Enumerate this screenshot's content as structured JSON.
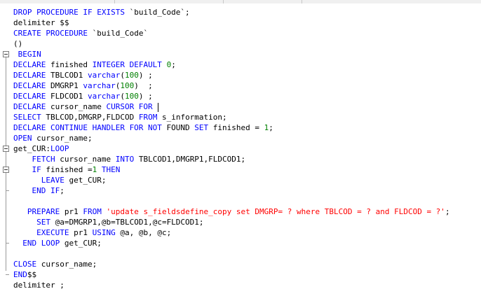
{
  "editor": {
    "colors": {
      "keyword": "#0000ff",
      "number": "#008000",
      "string": "#ff0000",
      "text": "#000000"
    },
    "lines": [
      [
        {
          "t": "DROP PROCEDURE IF EXISTS",
          "c": "kw"
        },
        {
          "t": " `build_Code`;",
          "c": "txt"
        }
      ],
      [
        {
          "t": "delimiter $$",
          "c": "txt"
        }
      ],
      [
        {
          "t": "CREATE PROCEDURE",
          "c": "kw"
        },
        {
          "t": " `build_Code`",
          "c": "txt"
        }
      ],
      [
        {
          "t": "()",
          "c": "txt"
        }
      ],
      [
        {
          "t": " BEGIN",
          "c": "kw"
        }
      ],
      [
        {
          "t": "DECLARE",
          "c": "kw"
        },
        {
          "t": " finished ",
          "c": "txt"
        },
        {
          "t": "INTEGER DEFAULT",
          "c": "kw"
        },
        {
          "t": " ",
          "c": "txt"
        },
        {
          "t": "0",
          "c": "num"
        },
        {
          "t": ";",
          "c": "txt"
        }
      ],
      [
        {
          "t": "DECLARE",
          "c": "kw"
        },
        {
          "t": " TBLCOD1 ",
          "c": "txt"
        },
        {
          "t": "varchar",
          "c": "kw"
        },
        {
          "t": "(",
          "c": "txt"
        },
        {
          "t": "100",
          "c": "num"
        },
        {
          "t": ") ;",
          "c": "txt"
        }
      ],
      [
        {
          "t": "DECLARE",
          "c": "kw"
        },
        {
          "t": " DMGRP1 ",
          "c": "txt"
        },
        {
          "t": "varchar",
          "c": "kw"
        },
        {
          "t": "(",
          "c": "txt"
        },
        {
          "t": "100",
          "c": "num"
        },
        {
          "t": ")  ;",
          "c": "txt"
        }
      ],
      [
        {
          "t": "DECLARE",
          "c": "kw"
        },
        {
          "t": " FLDCOD1 ",
          "c": "txt"
        },
        {
          "t": "varchar",
          "c": "kw"
        },
        {
          "t": "(",
          "c": "txt"
        },
        {
          "t": "100",
          "c": "num"
        },
        {
          "t": ") ;",
          "c": "txt"
        }
      ],
      [
        {
          "t": "DECLARE",
          "c": "kw"
        },
        {
          "t": " cursor_name ",
          "c": "txt"
        },
        {
          "t": "CURSOR FOR",
          "c": "kw"
        },
        {
          "t": " ",
          "c": "txt"
        }
      ],
      [
        {
          "t": "SELECT",
          "c": "kw"
        },
        {
          "t": " TBLCOD,DMGRP,FLDCOD ",
          "c": "txt"
        },
        {
          "t": "FROM",
          "c": "kw"
        },
        {
          "t": " s_information;",
          "c": "txt"
        }
      ],
      [
        {
          "t": "DECLARE CONTINUE HANDLER FOR NOT",
          "c": "kw"
        },
        {
          "t": " FOUND ",
          "c": "txt"
        },
        {
          "t": "SET",
          "c": "kw"
        },
        {
          "t": " finished = ",
          "c": "txt"
        },
        {
          "t": "1",
          "c": "num"
        },
        {
          "t": ";",
          "c": "txt"
        }
      ],
      [
        {
          "t": "OPEN",
          "c": "kw"
        },
        {
          "t": " cursor_name;",
          "c": "txt"
        }
      ],
      [
        {
          "t": "get_CUR:",
          "c": "txt"
        },
        {
          "t": "LOOP",
          "c": "kw"
        }
      ],
      [
        {
          "t": "    ",
          "c": "txt"
        },
        {
          "t": "FETCH",
          "c": "kw"
        },
        {
          "t": " cursor_name ",
          "c": "txt"
        },
        {
          "t": "INTO",
          "c": "kw"
        },
        {
          "t": " TBLCOD1,DMGRP1,FLDCOD1;",
          "c": "txt"
        }
      ],
      [
        {
          "t": "    ",
          "c": "txt"
        },
        {
          "t": "IF",
          "c": "kw"
        },
        {
          "t": " finished =",
          "c": "txt"
        },
        {
          "t": "1",
          "c": "num"
        },
        {
          "t": " ",
          "c": "txt"
        },
        {
          "t": "THEN",
          "c": "kw"
        }
      ],
      [
        {
          "t": "      ",
          "c": "txt"
        },
        {
          "t": "LEAVE",
          "c": "kw"
        },
        {
          "t": " get_CUR;",
          "c": "txt"
        }
      ],
      [
        {
          "t": "    ",
          "c": "txt"
        },
        {
          "t": "END IF",
          "c": "kw"
        },
        {
          "t": ";",
          "c": "txt"
        }
      ],
      [],
      [
        {
          "t": "   ",
          "c": "txt"
        },
        {
          "t": "PREPARE",
          "c": "kw"
        },
        {
          "t": " pr1 ",
          "c": "txt"
        },
        {
          "t": "FROM",
          "c": "kw"
        },
        {
          "t": " ",
          "c": "txt"
        },
        {
          "t": "'update s_fieldsdefine_copy set DMGRP= ? where TBLCOD = ? and FLDCOD = ?'",
          "c": "str"
        },
        {
          "t": ";",
          "c": "txt"
        }
      ],
      [
        {
          "t": "     ",
          "c": "txt"
        },
        {
          "t": "SET",
          "c": "kw"
        },
        {
          "t": " @a=DMGRP1,@b=TBLCOD1,@c=FLDCOD1;",
          "c": "txt"
        }
      ],
      [
        {
          "t": "     ",
          "c": "txt"
        },
        {
          "t": "EXECUTE",
          "c": "kw"
        },
        {
          "t": " pr1 ",
          "c": "txt"
        },
        {
          "t": "USING",
          "c": "kw"
        },
        {
          "t": " @a, @b, @c;",
          "c": "txt"
        }
      ],
      [
        {
          "t": "  ",
          "c": "txt"
        },
        {
          "t": "END LOOP",
          "c": "kw"
        },
        {
          "t": " get_CUR;",
          "c": "txt"
        }
      ],
      [],
      [
        {
          "t": "CLOSE",
          "c": "kw"
        },
        {
          "t": " cursor_name;",
          "c": "txt"
        }
      ],
      [
        {
          "t": "END",
          "c": "kw"
        },
        {
          "t": "$$",
          "c": "txt"
        }
      ],
      [
        {
          "t": "delimiter ;",
          "c": "txt"
        }
      ]
    ]
  }
}
